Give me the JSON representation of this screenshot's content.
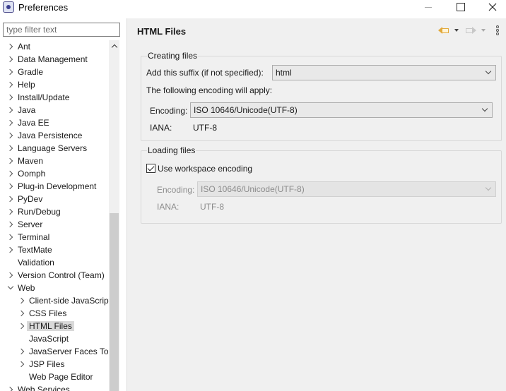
{
  "window": {
    "title": "Preferences",
    "icon": "eclipse-app-icon"
  },
  "filter": {
    "placeholder": "type filter text",
    "value": ""
  },
  "tree": {
    "items": [
      {
        "label": "Ant",
        "level": 0,
        "expander": "collapsed"
      },
      {
        "label": "Data Management",
        "level": 0,
        "expander": "collapsed"
      },
      {
        "label": "Gradle",
        "level": 0,
        "expander": "collapsed"
      },
      {
        "label": "Help",
        "level": 0,
        "expander": "collapsed"
      },
      {
        "label": "Install/Update",
        "level": 0,
        "expander": "collapsed"
      },
      {
        "label": "Java",
        "level": 0,
        "expander": "collapsed"
      },
      {
        "label": "Java EE",
        "level": 0,
        "expander": "collapsed"
      },
      {
        "label": "Java Persistence",
        "level": 0,
        "expander": "collapsed"
      },
      {
        "label": "Language Servers",
        "level": 0,
        "expander": "collapsed"
      },
      {
        "label": "Maven",
        "level": 0,
        "expander": "collapsed"
      },
      {
        "label": "Oomph",
        "level": 0,
        "expander": "collapsed"
      },
      {
        "label": "Plug-in Development",
        "level": 0,
        "expander": "collapsed"
      },
      {
        "label": "PyDev",
        "level": 0,
        "expander": "collapsed"
      },
      {
        "label": "Run/Debug",
        "level": 0,
        "expander": "collapsed"
      },
      {
        "label": "Server",
        "level": 0,
        "expander": "collapsed"
      },
      {
        "label": "Terminal",
        "level": 0,
        "expander": "collapsed"
      },
      {
        "label": "TextMate",
        "level": 0,
        "expander": "collapsed"
      },
      {
        "label": "Validation",
        "level": 0,
        "expander": "none"
      },
      {
        "label": "Version Control (Team)",
        "level": 0,
        "expander": "collapsed"
      },
      {
        "label": "Web",
        "level": 0,
        "expander": "expanded"
      },
      {
        "label": "Client-side JavaScript",
        "level": 1,
        "expander": "collapsed"
      },
      {
        "label": "CSS Files",
        "level": 1,
        "expander": "collapsed"
      },
      {
        "label": "HTML Files",
        "level": 1,
        "expander": "collapsed",
        "selected": true
      },
      {
        "label": "JavaScript",
        "level": 1,
        "expander": "none"
      },
      {
        "label": "JavaServer Faces Tools",
        "level": 1,
        "expander": "collapsed"
      },
      {
        "label": "JSP Files",
        "level": 1,
        "expander": "collapsed"
      },
      {
        "label": "Web Page Editor",
        "level": 1,
        "expander": "none"
      },
      {
        "label": "Web Services",
        "level": 0,
        "expander": "collapsed"
      }
    ]
  },
  "page": {
    "title": "HTML Files"
  },
  "creating_files": {
    "title": "Creating files",
    "suffix_label": "Add this suffix (if not specified):",
    "suffix_value": "html",
    "encoding_note": "The following encoding will apply:",
    "encoding_label": "Encoding:",
    "encoding_value": "ISO 10646/Unicode(UTF-8)",
    "iana_label": "IANA:",
    "iana_value": "UTF-8"
  },
  "loading_files": {
    "title": "Loading files",
    "checkbox_label": "Use workspace encoding",
    "checked": true,
    "encoding_label": "Encoding:",
    "encoding_value": "ISO 10646/Unicode(UTF-8)",
    "iana_label": "IANA:",
    "iana_value": "UTF-8"
  },
  "colors": {
    "panel_bg": "#f0f0f0",
    "selection_bg": "#d9d9d9",
    "back_arrow": "#e2a93b"
  }
}
